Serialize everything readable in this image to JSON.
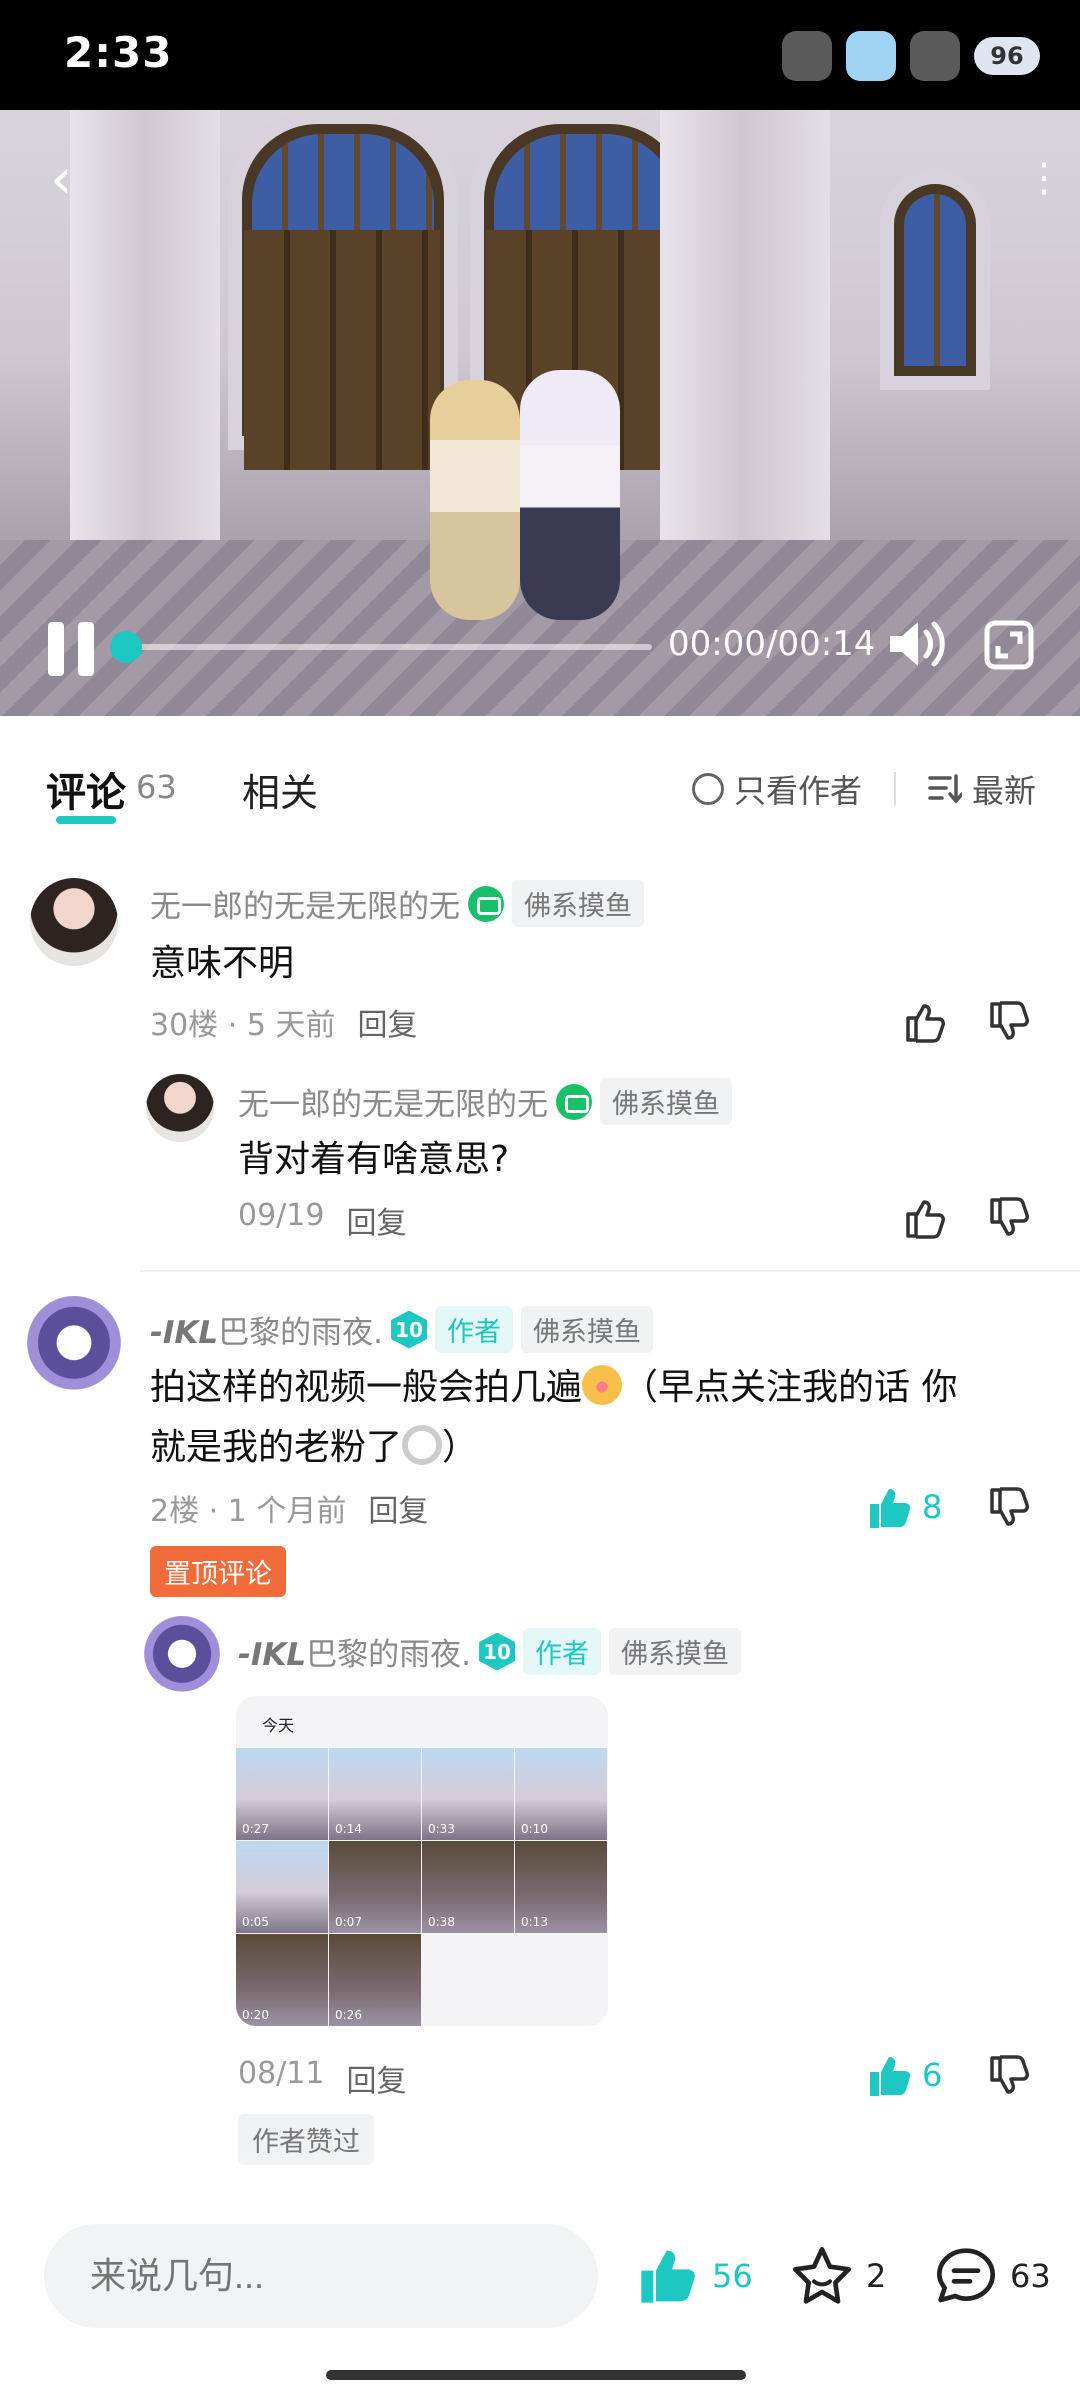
{
  "status_bar": {
    "time": "2:33",
    "battery": "96"
  },
  "video": {
    "time_readout": "00:00/00:14",
    "progress": 0.0
  },
  "tabs": {
    "comments_label": "评论",
    "comments_count": "63",
    "related_label": "相关",
    "author_only_label": "只看作者",
    "sort_label": "最新"
  },
  "comments": [
    {
      "username": "无一郎的无是无限的无",
      "tag": "佛系摸鱼",
      "text": "意味不明",
      "floor": "30楼",
      "sep": "·",
      "time": "5 天前",
      "reply_label": "回复",
      "reply": {
        "username": "无一郎的无是无限的无",
        "tag": "佛系摸鱼",
        "text": "背对着有啥意思?",
        "date": "09/19",
        "reply_label": "回复"
      }
    },
    {
      "name_prefix": "-IKL",
      "username": "巴黎的雨夜.",
      "level": "10",
      "author_tag": "作者",
      "tag": "佛系摸鱼",
      "text_line1": "拍这样的视频一般会拍几遍",
      "text_line1_tail": "（早点关注我的话 你",
      "text_line2": "就是我的老粉了",
      "text_line2_tail": "）",
      "floor": "2楼",
      "sep": "·",
      "time": "1 个月前",
      "reply_label": "回复",
      "likes": "8",
      "pinned_label": "置顶评论",
      "reply": {
        "name_prefix": "-IKL",
        "username": "巴黎的雨夜.",
        "level": "10",
        "author_tag": "作者",
        "tag": "佛系摸鱼",
        "image_label": "今天",
        "image_durations": [
          "0:27",
          "0:14",
          "0:33",
          "0:10",
          "0:05",
          "0:07",
          "0:38",
          "0:13",
          "0:20",
          "0:26"
        ],
        "date": "08/11",
        "reply_label": "回复",
        "likes": "6",
        "author_liked_label": "作者赞过"
      }
    }
  ],
  "bottom_bar": {
    "input_placeholder": "来说几句...",
    "likes": "56",
    "favorites": "2",
    "comments": "63"
  },
  "colors": {
    "accent": "#1ec8c2",
    "pinned": "#f26b3a",
    "game_icon": "#19c06a"
  }
}
